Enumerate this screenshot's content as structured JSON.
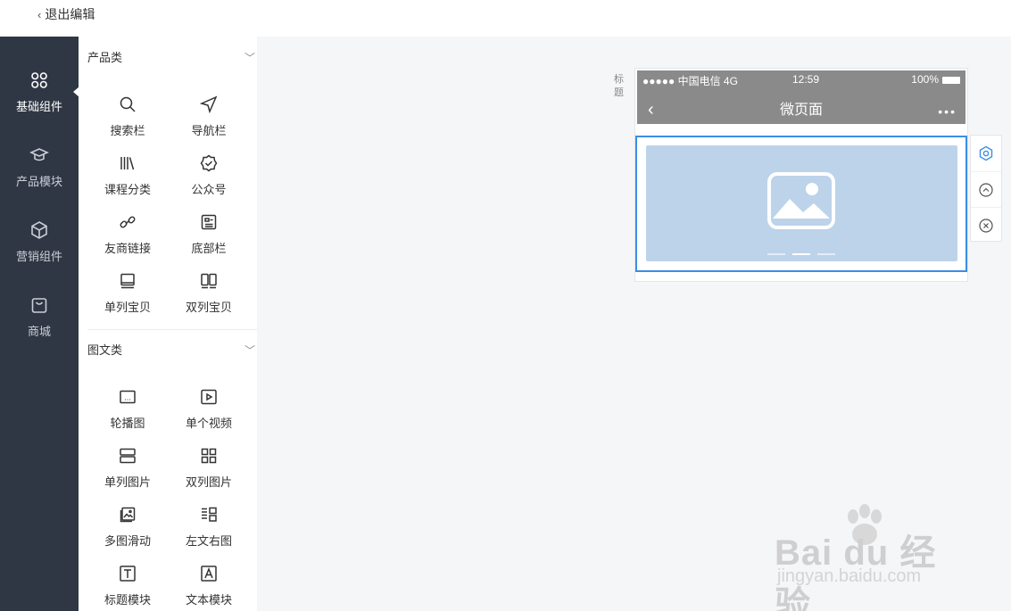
{
  "topbar": {
    "back_label": "退出编辑"
  },
  "leftnav": {
    "items": [
      {
        "label": "基础组件",
        "icon": "grid-icon",
        "active": true
      },
      {
        "label": "产品模块",
        "icon": "graduation-cap-icon"
      },
      {
        "label": "营销组件",
        "icon": "cube-icon"
      },
      {
        "label": "商城",
        "icon": "shopping-bag-icon"
      }
    ]
  },
  "panel": {
    "sections": [
      {
        "title": "产品类",
        "items": [
          {
            "label": "搜索栏",
            "icon": "search-icon"
          },
          {
            "label": "导航栏",
            "icon": "navigation-arrow-icon"
          },
          {
            "label": "课程分类",
            "icon": "books-icon"
          },
          {
            "label": "公众号",
            "icon": "verified-badge-icon"
          },
          {
            "label": "友商链接",
            "icon": "link-icon"
          },
          {
            "label": "底部栏",
            "icon": "id-card-icon"
          },
          {
            "label": "单列宝贝",
            "icon": "monitor-icon"
          },
          {
            "label": "双列宝贝",
            "icon": "two-columns-icon"
          }
        ]
      },
      {
        "title": "图文类",
        "items": [
          {
            "label": "轮播图",
            "icon": "carousel-icon"
          },
          {
            "label": "单个视频",
            "icon": "video-icon"
          },
          {
            "label": "单列图片",
            "icon": "single-column-image-icon"
          },
          {
            "label": "双列图片",
            "icon": "double-column-image-icon"
          },
          {
            "label": "多图滑动",
            "icon": "image-gallery-icon"
          },
          {
            "label": "左文右图",
            "icon": "text-left-image-right-icon"
          },
          {
            "label": "标题模块",
            "icon": "title-icon"
          },
          {
            "label": "文本模块",
            "icon": "text-icon"
          }
        ]
      }
    ]
  },
  "preview": {
    "side_label": "标题",
    "status_carrier": "●●●●● 中国电信 4G",
    "status_time": "12:59",
    "status_battery": "100%",
    "nav_back": "‹",
    "page_title": "微页面",
    "more": "•••",
    "carousel_slides": 3,
    "carousel_active_index": 1,
    "selection_color": "#3a8ee6",
    "banner_color": "#bcd3ea"
  },
  "toolbox": [
    {
      "icon": "settings-hexagon-icon"
    },
    {
      "icon": "move-up-icon"
    },
    {
      "icon": "delete-circle-icon"
    }
  ],
  "watermark": {
    "logo": "Bai  du 经验",
    "url": "jingyan.baidu.com"
  }
}
